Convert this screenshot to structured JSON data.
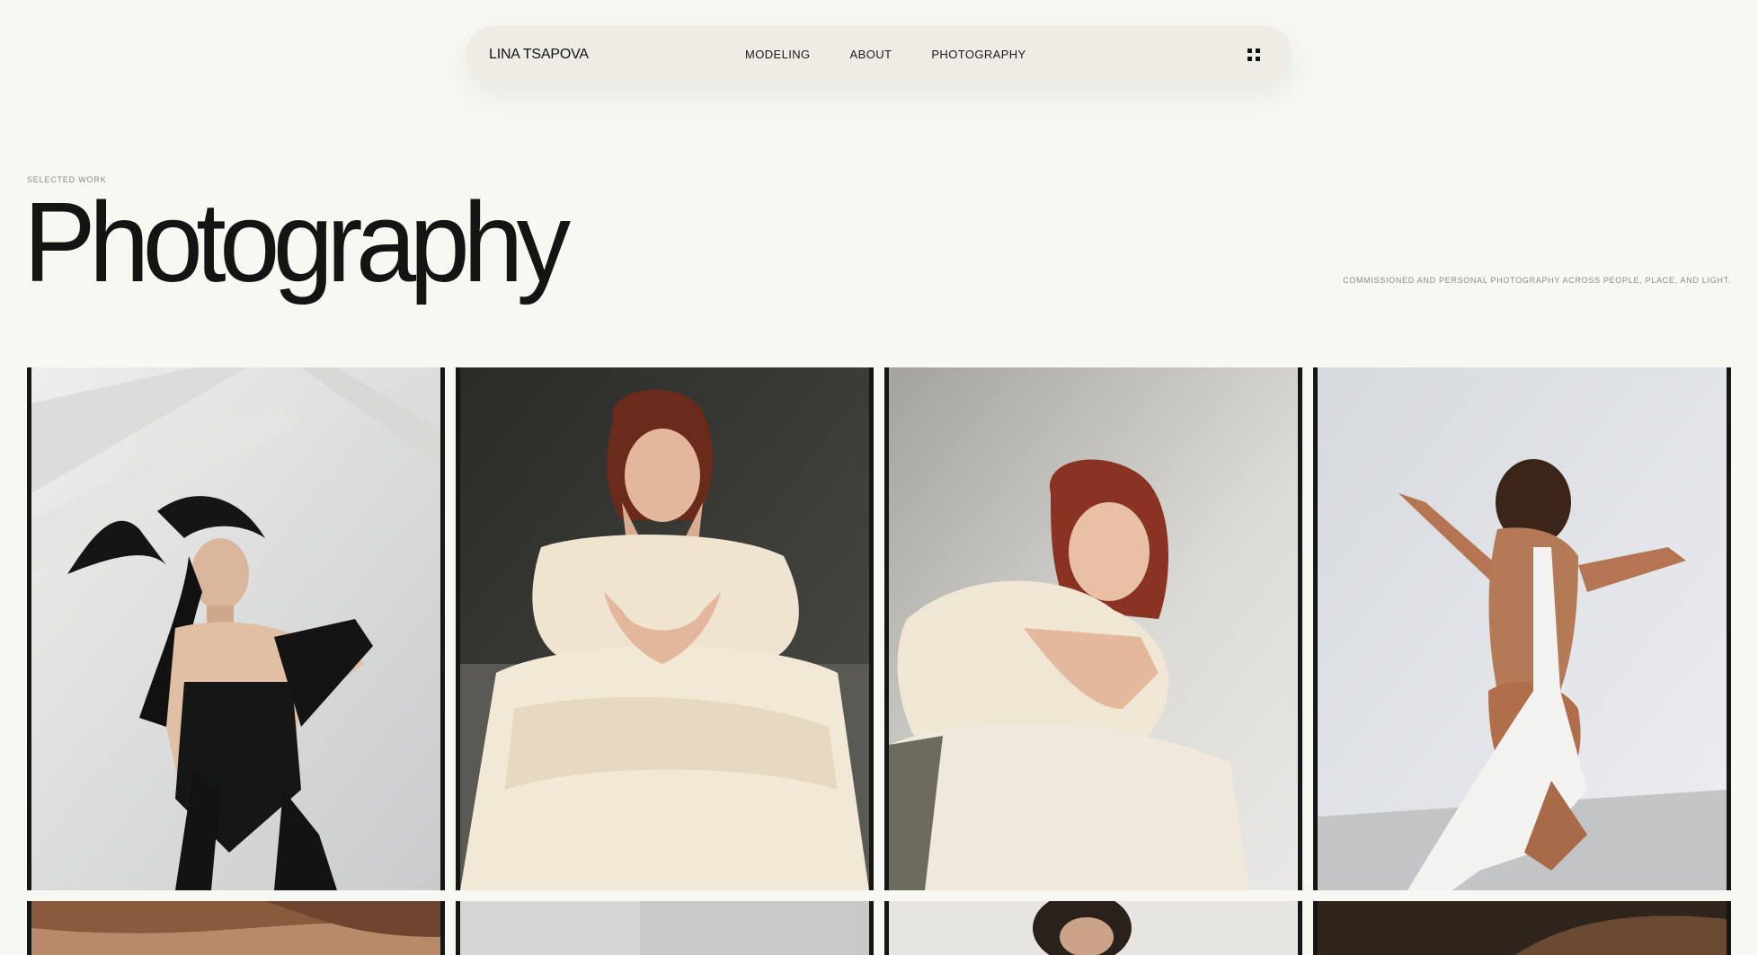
{
  "nav": {
    "brand": "LINA TSAPOVA",
    "links": [
      "MODELING",
      "ABOUT",
      "PHOTOGRAPHY"
    ],
    "menu_icon": "grid-menu-icon"
  },
  "hero": {
    "eyebrow": "SELECTED WORK",
    "title": "Photography",
    "tagline": "COMMISSIONED AND PERSONAL PHOTOGRAPHY ACROSS PEOPLE, PLACE, AND LIGHT."
  },
  "gallery": {
    "photos": [
      {
        "subject": "woman in black corset with flying hair, white ceiling beams"
      },
      {
        "subject": "red-haired woman in cream dress, hands on cheeks, dark backdrop"
      },
      {
        "subject": "red-haired woman in cream dress leaning, light backdrop"
      },
      {
        "subject": "woman in white apron facing wall, back view"
      },
      {
        "subject": "partial photo, warm skin tones"
      },
      {
        "subject": "partial photo, grey backdrop"
      },
      {
        "subject": "partial photo, dark hair"
      },
      {
        "subject": "partial photo, dark tones"
      }
    ]
  },
  "colors": {
    "background": "#f8f8f3",
    "nav_pill": "#efece5",
    "text": "#111111",
    "muted": "#8a8a86"
  }
}
